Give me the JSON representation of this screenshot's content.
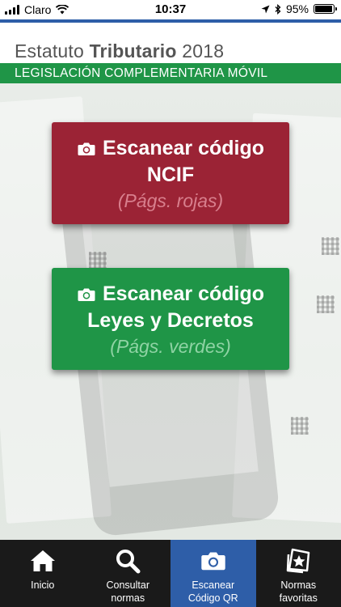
{
  "status_bar": {
    "carrier": "Claro",
    "time": "10:37",
    "battery_percent": "95%",
    "battery_level": 0.95
  },
  "header": {
    "title_part1": "Estatuto ",
    "title_bold": "Tributario",
    "title_part2": " 2018",
    "subtitle": "LEGISLACIÓN COMPLEMENTARIA MÓVIL"
  },
  "buttons": {
    "ncif": {
      "line1": "Escanear código",
      "line2": "NCIF",
      "line3": "(Págs. rojas)",
      "icon": "camera-icon"
    },
    "leyes": {
      "line1": "Escanear código",
      "line2": "Leyes y Decretos",
      "line3": "(Págs. verdes)",
      "icon": "camera-icon"
    }
  },
  "nav": {
    "items": [
      {
        "label": "Inicio",
        "icon": "home-icon"
      },
      {
        "label": "Consultar\nnormas",
        "icon": "search-icon"
      },
      {
        "label": "Escanear\nCódigo QR",
        "icon": "camera-icon"
      },
      {
        "label": "Normas\nfavoritas",
        "icon": "favorite-norms-icon"
      }
    ],
    "active_index": 2
  },
  "colors": {
    "red_button": "#9b2335",
    "green_accent": "#1f9547",
    "blue_active": "#2e5ea8",
    "nav_bg": "#1a1a1a"
  }
}
